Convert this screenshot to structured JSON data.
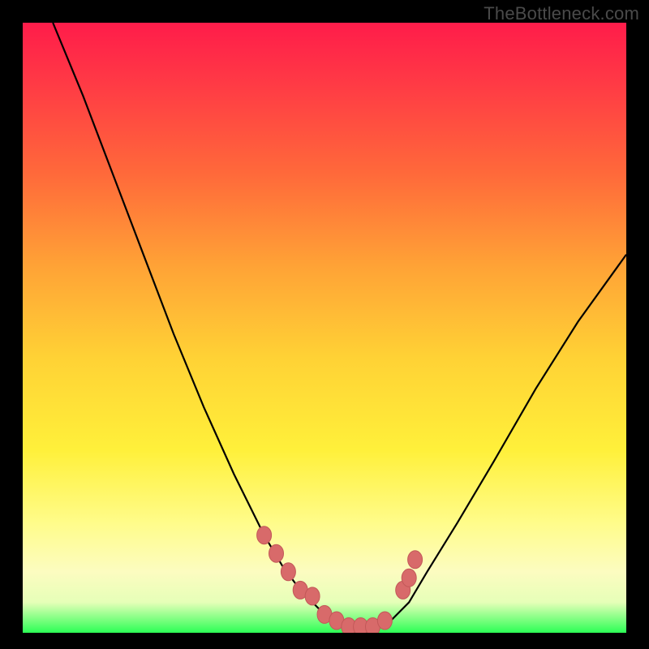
{
  "watermark": "TheBottleneck.com",
  "chart_data": {
    "type": "line",
    "title": "",
    "xlabel": "",
    "ylabel": "",
    "xlim": [
      0,
      100
    ],
    "ylim": [
      0,
      100
    ],
    "grid": false,
    "legend": false,
    "gradient_background": {
      "direction": "vertical",
      "stops": [
        {
          "pos": 0,
          "color": "#ff1c4a"
        },
        {
          "pos": 25,
          "color": "#ff6a3a"
        },
        {
          "pos": 55,
          "color": "#ffd235"
        },
        {
          "pos": 82,
          "color": "#fffc8a"
        },
        {
          "pos": 95,
          "color": "#e6ffb8"
        },
        {
          "pos": 100,
          "color": "#2cff55"
        }
      ]
    },
    "series": [
      {
        "name": "bottleneck-curve",
        "x": [
          5,
          10,
          15,
          20,
          25,
          30,
          35,
          40,
          43,
          46,
          49,
          52,
          55,
          58,
          61,
          64,
          67,
          72,
          78,
          85,
          92,
          100
        ],
        "y": [
          100,
          88,
          75,
          62,
          49,
          37,
          26,
          16,
          11,
          7,
          4,
          2,
          1,
          1,
          2,
          5,
          10,
          18,
          28,
          40,
          51,
          62
        ]
      }
    ],
    "markers": {
      "name": "highlighted-points",
      "color": "#d86a6a",
      "x": [
        40,
        42,
        44,
        46,
        48,
        50,
        52,
        54,
        56,
        58,
        60,
        63,
        64,
        65
      ],
      "y": [
        16,
        13,
        10,
        7,
        6,
        3,
        2,
        1,
        1,
        1,
        2,
        7,
        9,
        12
      ]
    }
  }
}
